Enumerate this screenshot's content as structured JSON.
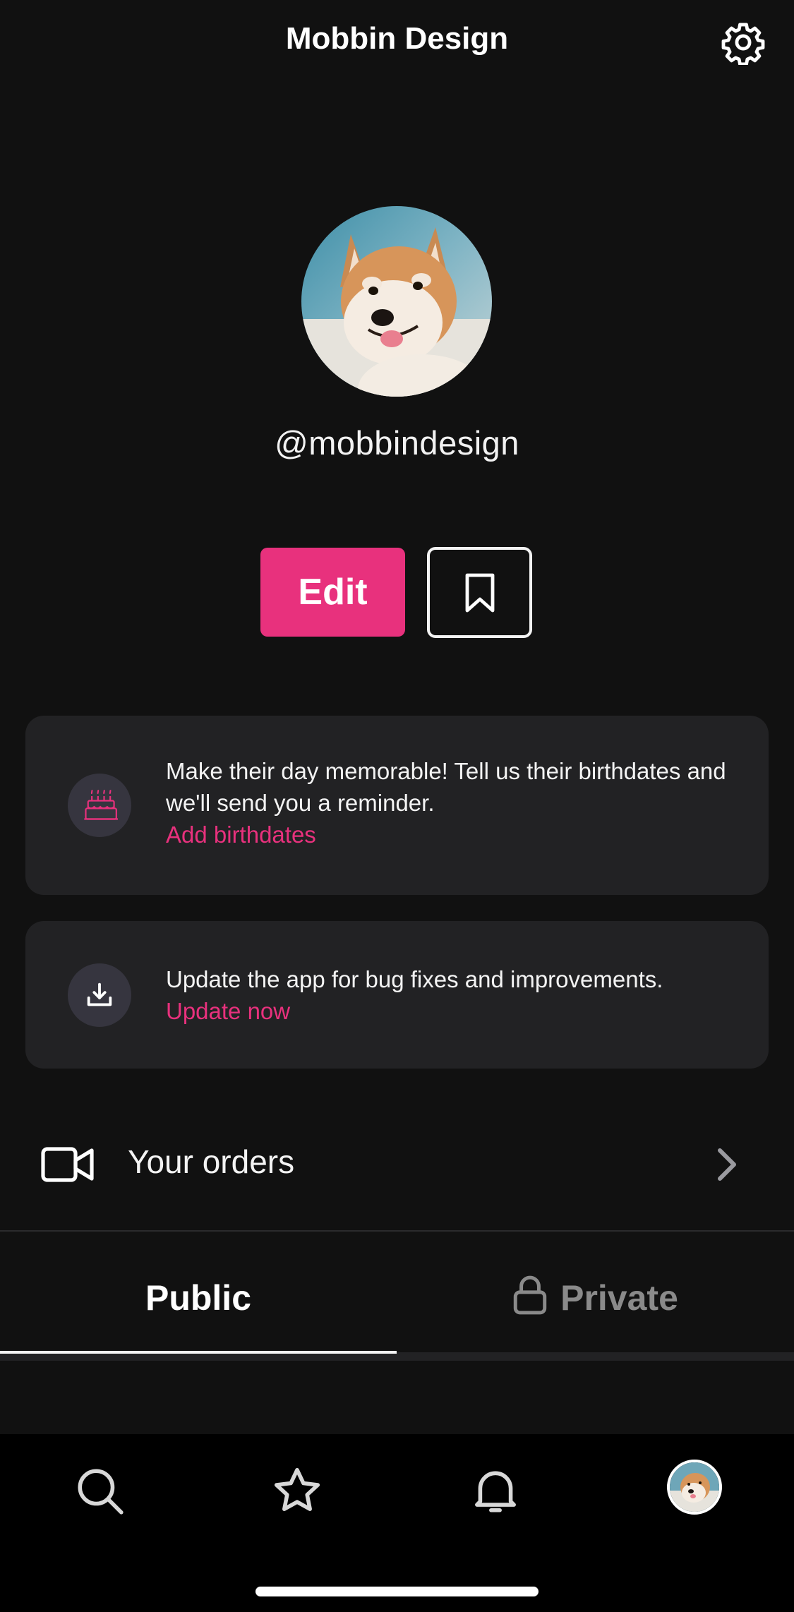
{
  "header": {
    "title": "Mobbin Design",
    "settings_icon": "gear-icon"
  },
  "profile": {
    "username": "@mobbindesign",
    "avatar": "dog-avatar-image"
  },
  "actions": {
    "edit_label": "Edit",
    "bookmark_icon": "bookmark-icon"
  },
  "cards": [
    {
      "icon": "birthday-cake-icon",
      "text": "Make their day memorable! Tell us their birthdates and we'll send you a reminder.",
      "link": "Add birthdates"
    },
    {
      "icon": "download-icon",
      "text": "Update the app for bug fixes and improvements.",
      "link": "Update now"
    }
  ],
  "orders": {
    "label": "Your orders",
    "icon": "video-camera-icon",
    "chevron_icon": "chevron-right-icon"
  },
  "tabs": [
    {
      "label": "Public",
      "active": true
    },
    {
      "label": "Private",
      "active": false,
      "icon": "lock-icon"
    }
  ],
  "bottom_nav": {
    "items": [
      "search-icon",
      "star-icon",
      "bell-icon",
      "profile-avatar"
    ]
  },
  "colors": {
    "accent": "#e8317d",
    "background": "#111111",
    "card": "#222224"
  }
}
